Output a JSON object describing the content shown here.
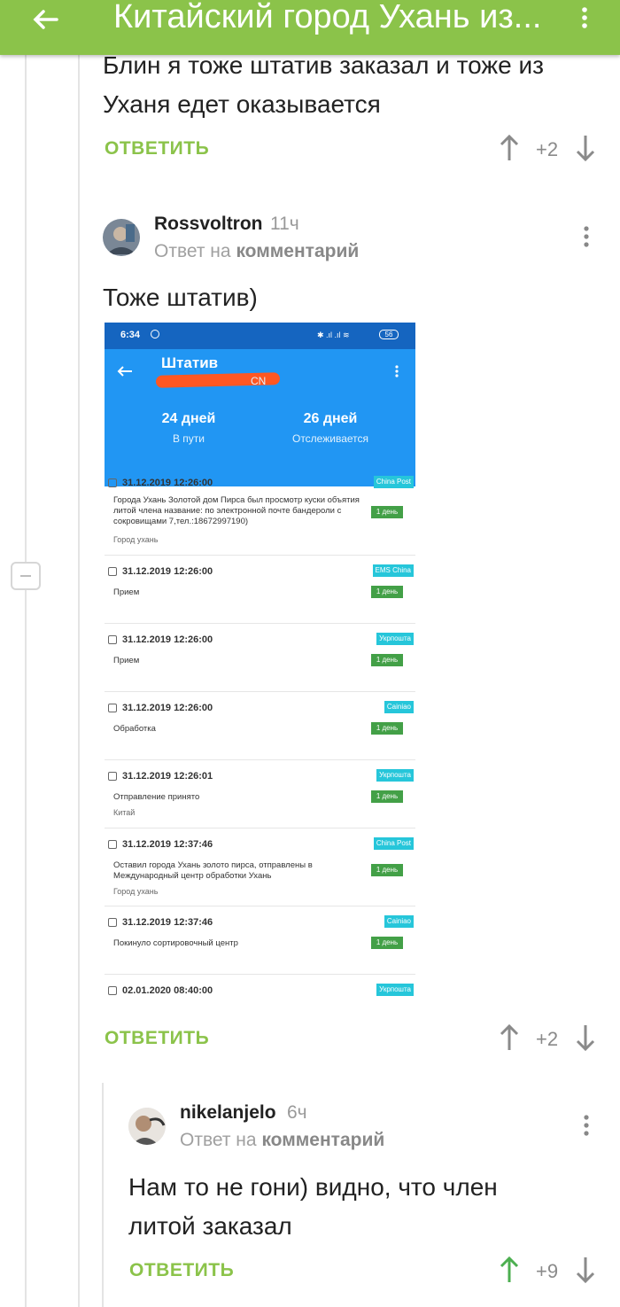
{
  "topbar": {
    "title": "Китайский город Ухань из..."
  },
  "comment1": {
    "text_line1": "Блин я тоже штатив заказал и тоже из",
    "text_line2": "Уханя едет оказывается",
    "reply_label": "ОТВЕТИТЬ",
    "rating": "+2"
  },
  "comment2": {
    "username": "Rossvoltron",
    "time": "11ч",
    "reply_to_prefix": "Ответ на",
    "reply_to_link": "комментарий",
    "text": "Тоже штатив)",
    "reply_label": "ОТВЕТИТЬ",
    "rating": "+2",
    "screenshot": {
      "status_time": "6:34",
      "status_battery": "56",
      "title": "Штатив",
      "subtitle_fragment": "CN",
      "stat1_value": "24 дней",
      "stat1_label": "В пути",
      "stat2_value": "26 дней",
      "stat2_label": "Отслеживается",
      "events": [
        {
          "datetime": "31.12.2019 12:26:00",
          "source": "China Post",
          "desc": "Города Ухань Золотой дом Пирса был просмотр куски объятия литой члена название: по электронной почте бандероли с сокровищами 7,тел.:18672997190)",
          "location": "Город ухань",
          "duration": "1 день"
        },
        {
          "datetime": "31.12.2019 12:26:00",
          "source": "EMS China",
          "desc": "Прием",
          "location": "",
          "duration": "1 день"
        },
        {
          "datetime": "31.12.2019 12:26:00",
          "source": "Укрпошта",
          "desc": "Прием",
          "location": "",
          "duration": "1 день"
        },
        {
          "datetime": "31.12.2019 12:26:00",
          "source": "Cainiao",
          "desc": "Обработка",
          "location": "",
          "duration": "1 день"
        },
        {
          "datetime": "31.12.2019 12:26:01",
          "source": "Укрпошта",
          "desc": "Отправление принято",
          "location": "Китай",
          "duration": "1 день"
        },
        {
          "datetime": "31.12.2019 12:37:46",
          "source": "China Post",
          "desc": "Оставил города Ухань золото пирса, отправлены в Международный центр обработки Ухань",
          "location": "Город ухань",
          "duration": "1 день"
        },
        {
          "datetime": "31.12.2019 12:37:46",
          "source": "Cainiao",
          "desc": "Покинуло сортировочный центр",
          "location": "",
          "duration": "1 день"
        },
        {
          "datetime": "02.01.2020 08:40:00",
          "source": "Укрпошта",
          "desc": "",
          "location": "",
          "duration": ""
        }
      ]
    }
  },
  "comment3": {
    "username": "nikelanjelo",
    "time": "6ч",
    "reply_to_prefix": "Ответ на",
    "reply_to_link": "комментарий",
    "text_line1": "Нам то не гони) видно, что член",
    "text_line2": "литой заказал",
    "reply_label": "ОТВЕТИТЬ",
    "rating": "+9"
  },
  "colors": {
    "accent": "#8bc34a",
    "upvoted": "#4caf50",
    "muted": "#8a8a8a"
  }
}
